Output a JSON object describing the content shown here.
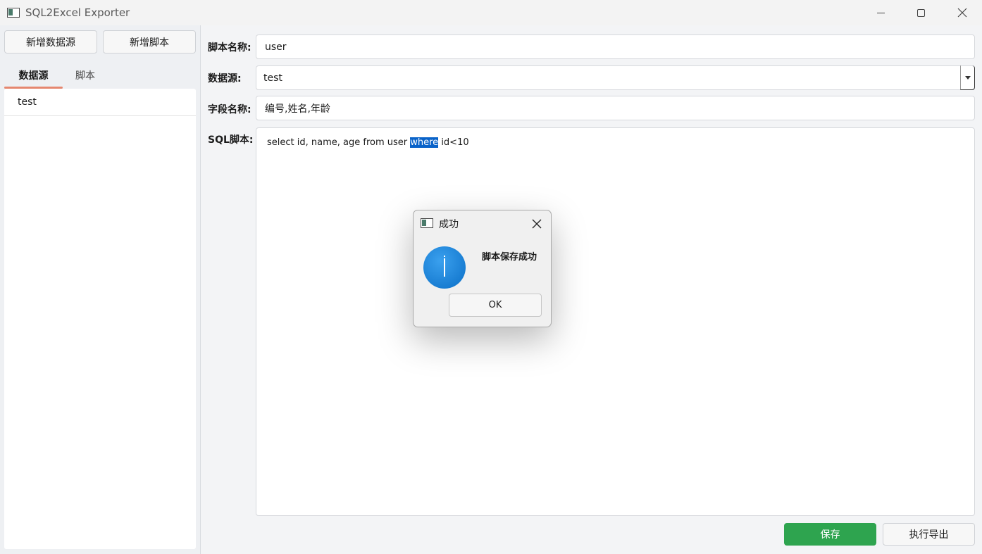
{
  "window": {
    "title": "SQL2Excel Exporter"
  },
  "left": {
    "add_datasource_label": "新增数据源",
    "add_script_label": "新增脚本",
    "tabs": [
      {
        "label": "数据源"
      },
      {
        "label": "脚本"
      }
    ],
    "items": [
      {
        "label": "test"
      }
    ]
  },
  "form": {
    "script_name_label": "脚本名称:",
    "script_name_value": "user",
    "datasource_label": "数据源:",
    "datasource_value": "test",
    "fields_label": "字段名称:",
    "fields_value": "编号,姓名,年龄",
    "sql_label": "SQL脚本:",
    "sql_before": "select id, name, age from user ",
    "sql_selected": "where",
    "sql_after": " id<10"
  },
  "actions": {
    "save_label": "保存",
    "export_label": "执行导出"
  },
  "dialog": {
    "title": "成功",
    "message": "脚本保存成功",
    "ok_label": "OK"
  },
  "colors": {
    "save_button": "#2ea44f",
    "tab_underline": "#e5876f",
    "selection": "#0a63c9",
    "info_icon": "#0b6fc7"
  }
}
